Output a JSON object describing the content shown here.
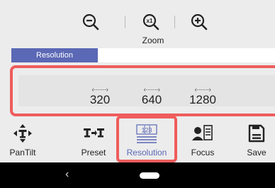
{
  "zoom": {
    "label": "Zoom",
    "zoom_out_icon": "zoom-out-icon",
    "zoom_reset_icon": "zoom-reset-x1-icon",
    "zoom_reset_badge": "x1",
    "zoom_in_icon": "zoom-in-icon"
  },
  "tab": {
    "active_label": "Resolution",
    "accent": "#5b68b5"
  },
  "resolution": {
    "options": [
      {
        "value": "320",
        "arrows": "‹·······›"
      },
      {
        "value": "640",
        "arrows": "‹·······›"
      },
      {
        "value": "1280",
        "arrows": "‹·······›"
      }
    ],
    "highlight_color": "#ef5c5c"
  },
  "toolbar": {
    "items": [
      {
        "label": "PanTilt",
        "icon": "pantilt-icon"
      },
      {
        "label": "Preset",
        "icon": "preset-icon"
      },
      {
        "label": "Resolution",
        "icon": "resolution-icon",
        "glyph": "123",
        "active": true
      },
      {
        "label": "Focus",
        "icon": "focus-icon"
      },
      {
        "label": "Save",
        "icon": "save-icon"
      }
    ]
  },
  "navbar": {
    "back_icon": "back-chevron-icon",
    "back_glyph": "‹",
    "home_icon": "home-pill-icon"
  }
}
